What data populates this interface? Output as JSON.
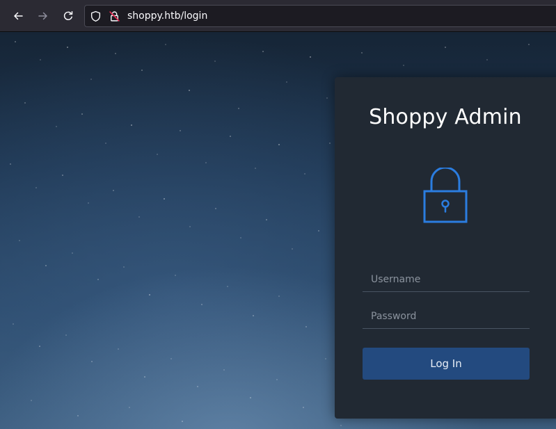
{
  "browser": {
    "url": "shoppy.htb/login",
    "icons": {
      "back": "arrow-left-icon",
      "forward": "arrow-right-icon",
      "reload": "reload-icon",
      "tracking": "shield-icon",
      "security": "insecure-lock-icon"
    }
  },
  "login": {
    "title": "Shoppy Admin",
    "icon": "padlock-icon",
    "username_placeholder": "Username",
    "password_placeholder": "Password",
    "submit_label": "Log In"
  },
  "colors": {
    "card_background": "#212933",
    "accent_blue": "#2b7de0",
    "button_background": "#234a7f",
    "page_background_top": "#162536",
    "page_background_bottom": "#3e5f80"
  }
}
